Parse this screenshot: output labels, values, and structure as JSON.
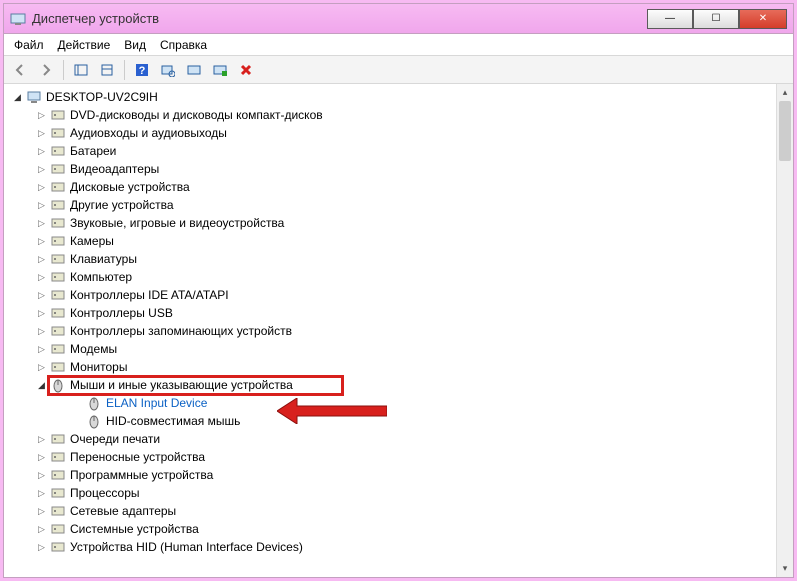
{
  "window_title": "Диспетчер устройств",
  "menu": {
    "file": "Файл",
    "action": "Действие",
    "view": "Вид",
    "help": "Справка"
  },
  "root": "DESKTOP-UV2C9IH",
  "categories": [
    {
      "label": "DVD-дисководы и дисководы компакт-дисков"
    },
    {
      "label": "Аудиовходы и аудиовыходы"
    },
    {
      "label": "Батареи"
    },
    {
      "label": "Видеоадаптеры"
    },
    {
      "label": "Дисковые устройства"
    },
    {
      "label": "Другие устройства"
    },
    {
      "label": "Звуковые, игровые и видеоустройства"
    },
    {
      "label": "Камеры"
    },
    {
      "label": "Клавиатуры"
    },
    {
      "label": "Компьютер"
    },
    {
      "label": "Контроллеры IDE ATA/ATAPI"
    },
    {
      "label": "Контроллеры USB"
    },
    {
      "label": "Контроллеры запоминающих устройств"
    },
    {
      "label": "Модемы"
    },
    {
      "label": "Мониторы"
    },
    {
      "label": "Мыши и иные указывающие устройства",
      "expanded": true,
      "highlighted": true,
      "children": [
        {
          "label": "ELAN Input Device",
          "selected": true
        },
        {
          "label": "HID-совместимая мышь"
        }
      ]
    },
    {
      "label": "Очереди печати"
    },
    {
      "label": "Переносные устройства"
    },
    {
      "label": "Программные устройства"
    },
    {
      "label": "Процессоры"
    },
    {
      "label": "Сетевые адаптеры"
    },
    {
      "label": "Системные устройства"
    },
    {
      "label": "Устройства HID (Human Interface Devices)"
    }
  ]
}
